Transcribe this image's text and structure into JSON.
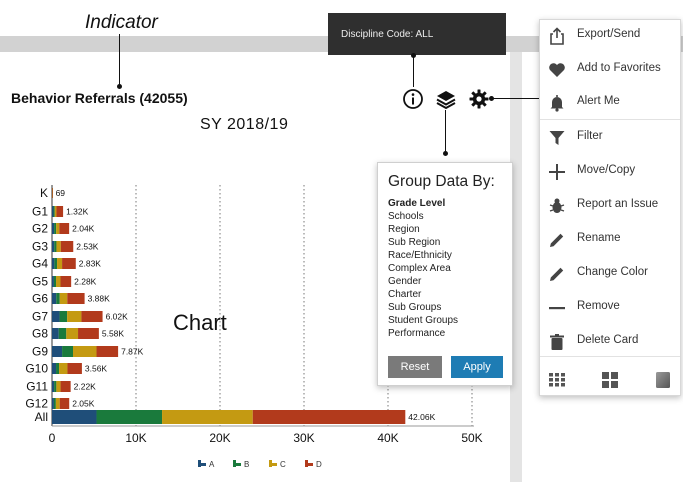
{
  "annotations": {
    "indicator": "Indicator",
    "chart": "Chart"
  },
  "card": {
    "title": "Behavior Referrals (42055)",
    "subtitle": "SY 2018/19",
    "tooltip": "Discipline Code: ALL",
    "icons": [
      "info-icon",
      "layers-icon",
      "gear-icon"
    ]
  },
  "group_popup": {
    "title": "Group Data By:",
    "options": [
      {
        "label": "Grade Level",
        "selected": true
      },
      {
        "label": "Schools",
        "selected": false
      },
      {
        "label": "Region",
        "selected": false
      },
      {
        "label": "Sub Region",
        "selected": false
      },
      {
        "label": "Race/Ethnicity",
        "selected": false
      },
      {
        "label": "Complex Area",
        "selected": false
      },
      {
        "label": "Gender",
        "selected": false
      },
      {
        "label": "Charter",
        "selected": false
      },
      {
        "label": "Sub Groups",
        "selected": false
      },
      {
        "label": "Student Groups",
        "selected": false
      },
      {
        "label": "Performance",
        "selected": false
      }
    ],
    "reset_label": "Reset",
    "apply_label": "Apply"
  },
  "menu": {
    "items": [
      {
        "label": "Export/Send",
        "icon": "export-icon"
      },
      {
        "label": "Add to Favorites",
        "icon": "heart-icon"
      },
      {
        "label": "Alert Me",
        "icon": "bell-icon"
      },
      {
        "label": "Filter",
        "icon": "filter-icon"
      },
      {
        "label": "Move/Copy",
        "icon": "plus-icon"
      },
      {
        "label": "Report an Issue",
        "icon": "bug-icon"
      },
      {
        "label": "Rename",
        "icon": "pencil-icon"
      },
      {
        "label": "Change Color",
        "icon": "pencil-icon"
      },
      {
        "label": "Remove",
        "icon": "minus-icon"
      },
      {
        "label": "Delete Card",
        "icon": "trash-icon"
      }
    ],
    "footer_icons": [
      "grid-small-icon",
      "grid-large-icon",
      "square-icon"
    ]
  },
  "colors": {
    "A": "#1f4e79",
    "B": "#1a7a3c",
    "C": "#c49a12",
    "D": "#b23a1c"
  },
  "chart_data": {
    "type": "bar",
    "orientation": "horizontal",
    "stacked": true,
    "categories": [
      "K",
      "G1",
      "G2",
      "G3",
      "G4",
      "G5",
      "G6",
      "G7",
      "G8",
      "G9",
      "G10",
      "G11",
      "G12",
      "All"
    ],
    "total_labels": [
      "69",
      "1.32K",
      "2.04K",
      "2.53K",
      "2.83K",
      "2.28K",
      "3.88K",
      "6.02K",
      "5.58K",
      "7.87K",
      "3.56K",
      "2.22K",
      "2.05K",
      "42.06K"
    ],
    "series": [
      {
        "name": "A",
        "values": [
          10,
          180,
          250,
          260,
          280,
          230,
          500,
          900,
          800,
          1200,
          480,
          250,
          230,
          5300
        ]
      },
      {
        "name": "B",
        "values": [
          10,
          150,
          240,
          270,
          320,
          250,
          420,
          900,
          900,
          1300,
          360,
          270,
          230,
          7800
        ]
      },
      {
        "name": "C",
        "values": [
          10,
          200,
          380,
          520,
          600,
          530,
          900,
          1700,
          1400,
          2800,
          1000,
          500,
          460,
          10800
        ]
      },
      {
        "name": "D",
        "values": [
          39,
          790,
          1170,
          1480,
          1630,
          1270,
          2060,
          2520,
          2480,
          2570,
          1720,
          1200,
          1130,
          18160
        ]
      }
    ],
    "xticks": [
      "0",
      "10K",
      "20K",
      "30K",
      "40K",
      "50K"
    ],
    "xlim": [
      0,
      50000
    ],
    "grid": true,
    "legend_position": "bottom"
  }
}
